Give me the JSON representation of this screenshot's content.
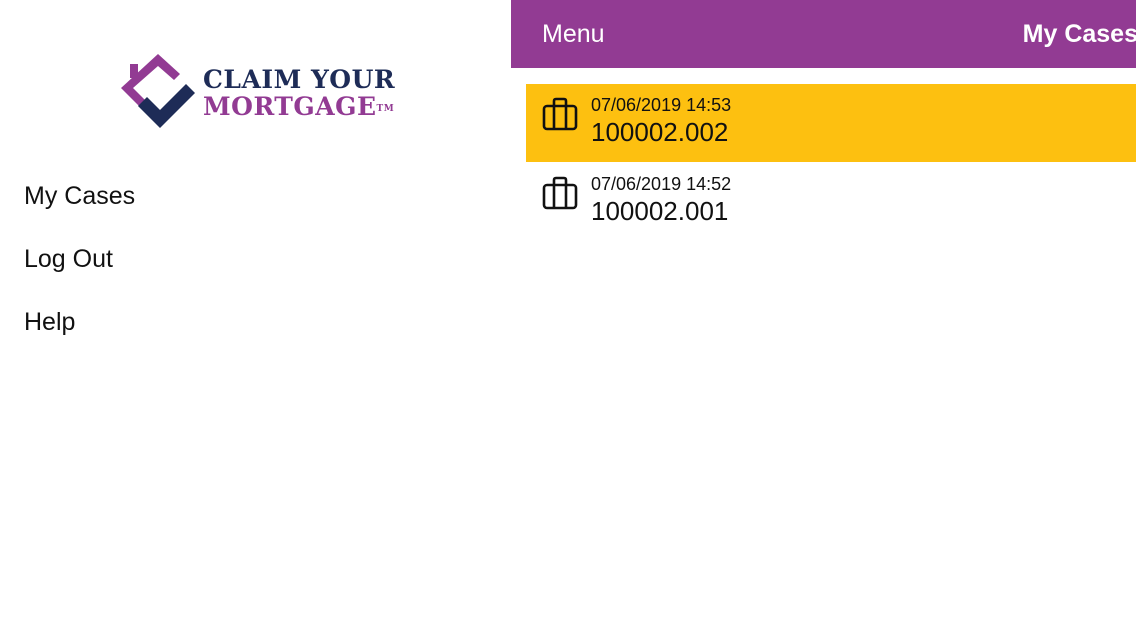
{
  "logo": {
    "line1": "CLAIM YOUR",
    "line2": "MORTGAGE",
    "tm": "TM"
  },
  "side_menu": {
    "items": [
      {
        "label": "My Cases"
      },
      {
        "label": "Log Out"
      },
      {
        "label": "Help"
      }
    ]
  },
  "nav_bar": {
    "menu_label": "Menu",
    "title": "My Cases"
  },
  "cases": [
    {
      "date": "07/06/2019 14:53",
      "number": "100002.002",
      "selected": true
    },
    {
      "date": "07/06/2019 14:52",
      "number": "100002.001",
      "selected": false
    }
  ],
  "colors": {
    "brand_purple": "#923b93",
    "brand_navy": "#1e2c57",
    "selected_row": "#fdc010"
  },
  "icons": {
    "case": "briefcase-icon",
    "logo_mark": "house-check-icon"
  }
}
